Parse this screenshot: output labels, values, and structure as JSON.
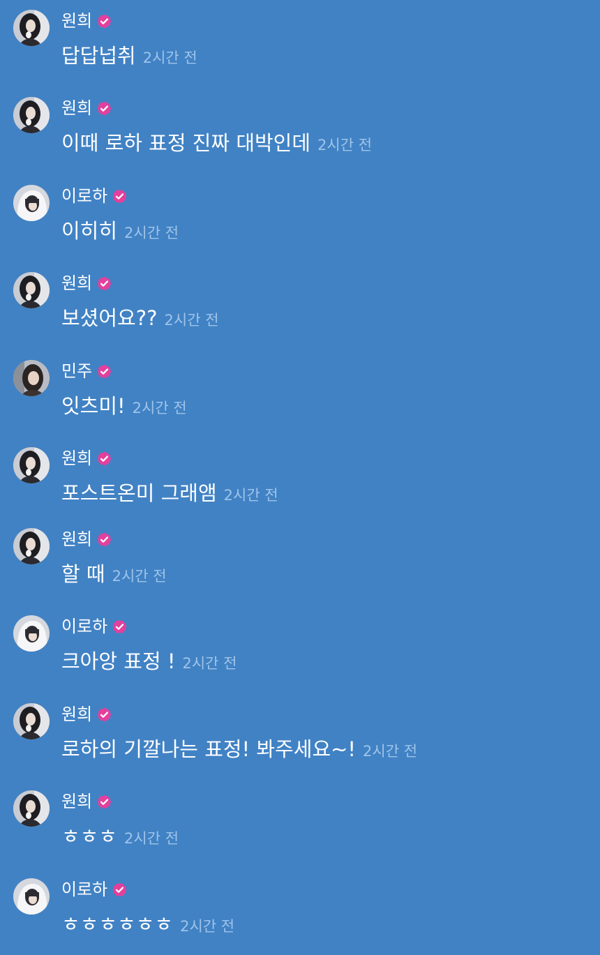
{
  "colors": {
    "background": "#4182c4",
    "text": "#ffffff",
    "time": "#9fc4ea",
    "badge": "#e3409e"
  },
  "messages": [
    {
      "user": "원희",
      "avatar": "wonhee-avatar",
      "text": "답답넙취",
      "time": "2시간 전"
    },
    {
      "user": "원희",
      "avatar": "wonhee-avatar",
      "text": "이때 로하 표정 진짜 대박인데",
      "time": "2시간 전"
    },
    {
      "user": "이로하",
      "avatar": "iroha-avatar",
      "text": "이히히",
      "time": "2시간 전"
    },
    {
      "user": "원희",
      "avatar": "wonhee-avatar",
      "text": "보셨어요??",
      "time": "2시간 전"
    },
    {
      "user": "민주",
      "avatar": "minju-avatar",
      "text": "잇츠미!",
      "time": "2시간 전"
    },
    {
      "user": "원희",
      "avatar": "wonhee-avatar",
      "text": "포스트온미 그래앰",
      "time": "2시간 전"
    },
    {
      "user": "원희",
      "avatar": "wonhee-avatar",
      "text": "할 때",
      "time": "2시간 전"
    },
    {
      "user": "이로하",
      "avatar": "iroha-avatar",
      "text": "크아앙 표정 !",
      "time": "2시간 전"
    },
    {
      "user": "원희",
      "avatar": "wonhee-avatar",
      "text": "로하의 기깔나는 표정! 봐주세요~!",
      "time": "2시간 전"
    },
    {
      "user": "원희",
      "avatar": "wonhee-avatar",
      "text": "ㅎㅎㅎ",
      "time": "2시간 전"
    },
    {
      "user": "이로하",
      "avatar": "iroha-avatar",
      "text": "ㅎㅎㅎㅎㅎㅎ",
      "time": "2시간 전"
    }
  ]
}
